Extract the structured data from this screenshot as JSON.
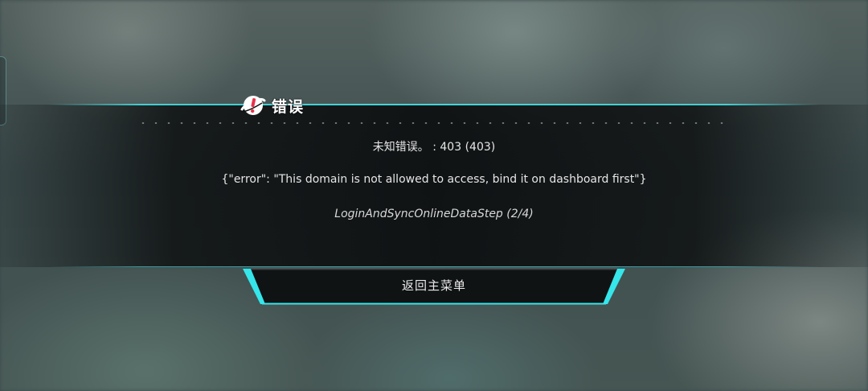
{
  "dialog": {
    "title": "错误",
    "error_code_line": "未知错误。 : 403 (403)",
    "error_detail": "{\"error\": \"This domain is not allowed to access, bind it on dashboard first\"}",
    "step_line": "LoginAndSyncOnlineDataStep (2/4)",
    "return_button_label": "返回主菜单",
    "icon": "alert-planet-icon"
  },
  "colors": {
    "accent": "#46dce1",
    "icon_red": "#e8324a",
    "panel": "#0c0e0f"
  }
}
